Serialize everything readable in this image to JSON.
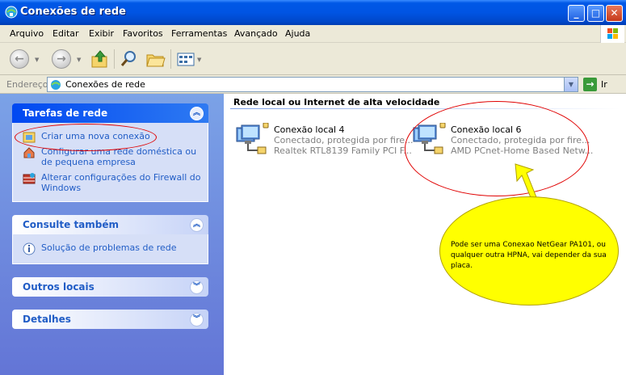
{
  "window": {
    "title": "Conexões de rede",
    "min_label": "_",
    "max_label": "□",
    "close_label": "✕"
  },
  "menu": [
    "Arquivo",
    "Editar",
    "Exibir",
    "Favoritos",
    "Ferramentas",
    "Avançado",
    "Ajuda"
  ],
  "toolbar": {
    "back_label": "←",
    "forward_label": "→"
  },
  "address": {
    "label": "Endereço",
    "value": "Conexões de rede",
    "go_label": "Ir"
  },
  "left_pane": {
    "tasks_panel": {
      "title": "Tarefas de rede",
      "items": [
        {
          "label": "Criar uma nova conexão",
          "icon": "new-connection-icon"
        },
        {
          "label": "Configurar uma rede doméstica ou de pequena empresa",
          "icon": "home-network-icon"
        },
        {
          "label": "Alterar configurações do Firewall do Windows",
          "icon": "firewall-icon"
        }
      ]
    },
    "see_also_panel": {
      "title": "Consulte também",
      "items": [
        {
          "label": "Solução de problemas de rede",
          "icon": "info-icon"
        }
      ]
    },
    "other_places_panel": {
      "title": "Outros locais"
    },
    "details_panel": {
      "title": "Detalhes"
    }
  },
  "right_pane": {
    "section_title": "Rede local ou Internet de alta velocidade",
    "connections": [
      {
        "name": "Conexão local 4",
        "status": "Conectado, protegida por fire...",
        "device": "Realtek RTL8139 Family PCI F..."
      },
      {
        "name": "Conexão local 6",
        "status": "Conectado, protegida por fire...",
        "device": "AMD PCnet-Home Based Netw..."
      }
    ]
  },
  "annotation": {
    "note_text": "Pode ser uma Conexao NetGear PA101, ou qualquer outra HPNA, vai depender da sua placa.",
    "oval_color": "#e00000",
    "note_color": "#ffff00"
  }
}
